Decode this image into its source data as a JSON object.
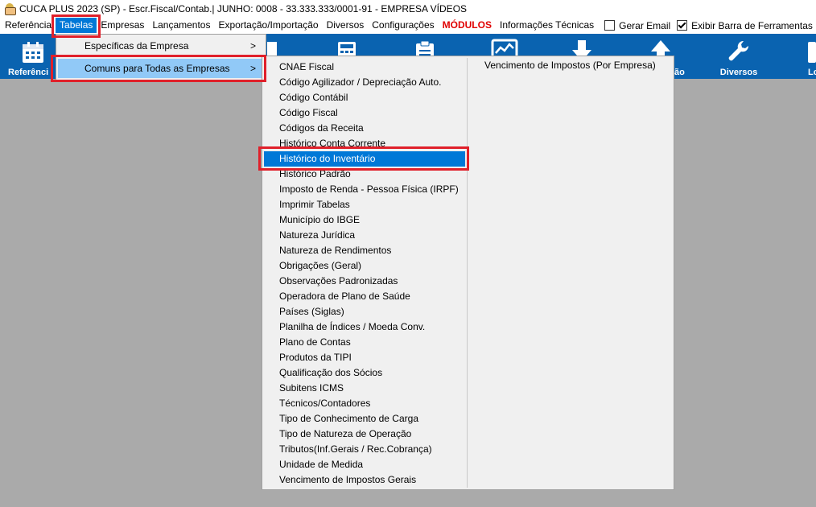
{
  "title": "CUCA PLUS 2023 (SP) - Escr.Fiscal/Contab.| JUNHO: 0008 - 33.333.333/0001-91 - EMPRESA VÍDEOS",
  "menubar": {
    "items": [
      "Referência",
      "Tabelas",
      "Empresas",
      "Lançamentos",
      "Exportação/Importação",
      "Diversos",
      "Configurações"
    ],
    "modulos": "MÓDULOS",
    "info": "Informações Técnicas",
    "gerar_email": "Gerar Email",
    "exibir_barra": "Exibir Barra de Ferramentas"
  },
  "toolbar": {
    "referencia": "Referênci",
    "diversos": "Diversos",
    "partial_label": "ão",
    "partial_right": "Lo"
  },
  "menu_tabelas": {
    "items": [
      "Específicas da Empresa",
      "Comuns para Todas as Empresas"
    ],
    "arrow": ">"
  },
  "menu_comuns": {
    "items": [
      "CNAE Fiscal",
      "Código Agilizador / Depreciação Auto.",
      "Código Contábil",
      "Código Fiscal",
      "Códigos da Receita",
      "Histórico Conta Corrente",
      "Histórico do Inventário",
      "Histórico Padrão",
      "Imposto de Renda - Pessoa Física (IRPF)",
      "Imprimir Tabelas",
      "Município do IBGE",
      "Natureza Jurídica",
      "Natureza de Rendimentos",
      "Obrigações (Geral)",
      "Observações Padronizadas",
      "Operadora de Plano de Saúde",
      "Países (Siglas)",
      "Planilha de Índices / Moeda Conv.",
      "Plano de Contas",
      "Produtos da TIPI",
      "Qualificação dos Sócios",
      "Subitens ICMS",
      "Técnicos/Contadores",
      "Tipo de Conhecimento de Carga",
      "Tipo de Natureza de Operação",
      "Tributos(Inf.Gerais / Rec.Cobrança)",
      "Unidade de Medida",
      "Vencimento de Impostos Gerais"
    ],
    "right_column": [
      "Vencimento de Impostos (Por Empresa)"
    ],
    "selected_index": 6
  }
}
